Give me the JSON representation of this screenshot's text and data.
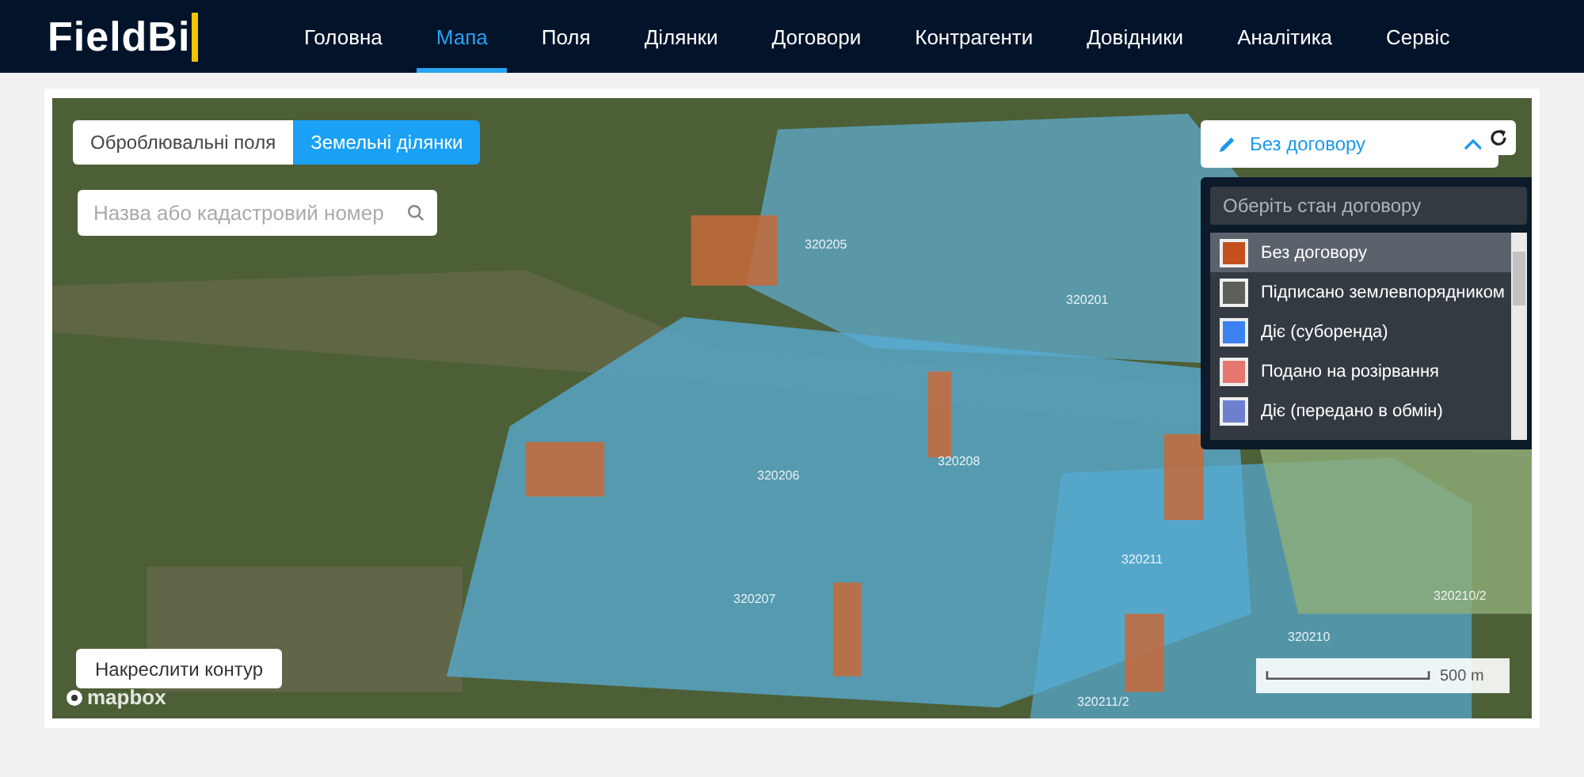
{
  "logo": {
    "text": "Field",
    "accent": "Bi"
  },
  "nav": [
    {
      "label": "Головна",
      "selected": false
    },
    {
      "label": "Мапа",
      "selected": true
    },
    {
      "label": "Поля",
      "selected": false
    },
    {
      "label": "Ділянки",
      "selected": false
    },
    {
      "label": "Договори",
      "selected": false
    },
    {
      "label": "Контрагенти",
      "selected": false
    },
    {
      "label": "Довідники",
      "selected": false
    },
    {
      "label": "Аналітика",
      "selected": false
    },
    {
      "label": "Сервіс",
      "selected": false
    }
  ],
  "layer_tabs": [
    {
      "label": "Оброблювальні поля",
      "selected": false
    },
    {
      "label": "Земельні ділянки",
      "selected": true
    }
  ],
  "search": {
    "placeholder": "Назва або кадастровий номер"
  },
  "status_button": {
    "label": "Без договору",
    "expanded": true
  },
  "status_dropdown": {
    "placeholder": "Оберіть стан договору",
    "items": [
      {
        "label": "Без договору",
        "color": "#c4501e",
        "selected": true
      },
      {
        "label": "Підписано землевпорядником",
        "color": "#5c5f5a",
        "selected": false
      },
      {
        "label": "Діє (суборенда)",
        "color": "#3b82f0",
        "selected": false
      },
      {
        "label": "Подано на розірвання",
        "color": "#e6766e",
        "selected": false
      },
      {
        "label": "Діє (передано в обмін)",
        "color": "#6f7fd0",
        "selected": false
      }
    ]
  },
  "parcel_labels": [
    "320205",
    "320201",
    "320206",
    "320208",
    "320207",
    "320211",
    "320210",
    "320210/2",
    "320211/2"
  ],
  "draw_button": "Накреслити контур",
  "attribution": "mapbox",
  "scale": "500 m"
}
